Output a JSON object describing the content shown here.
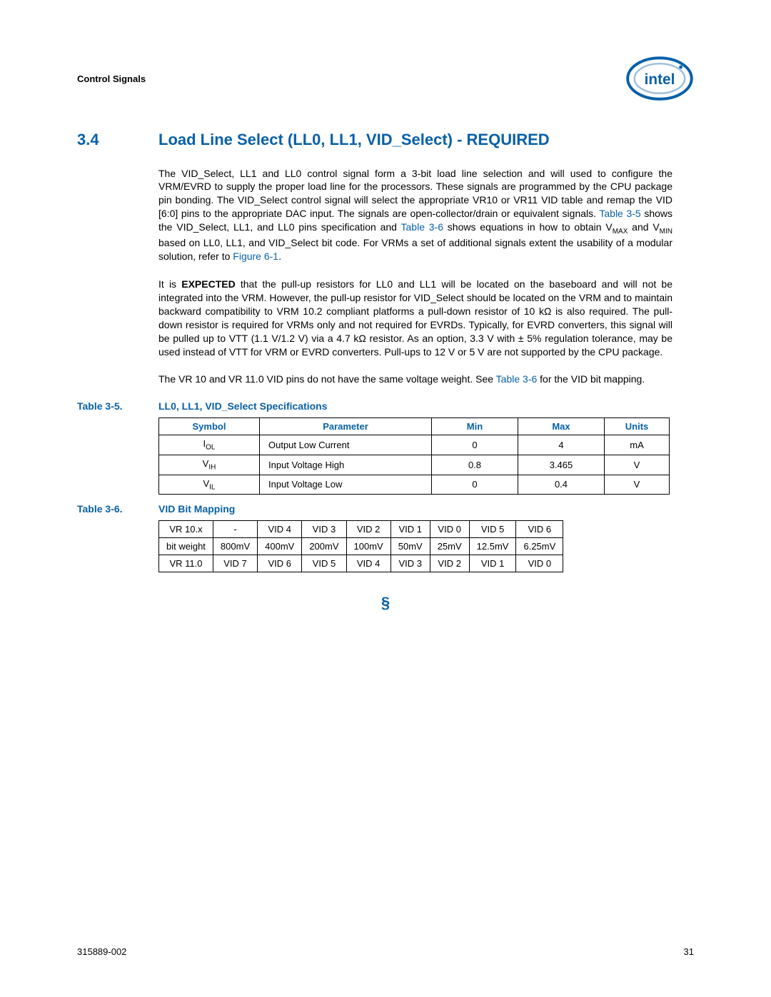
{
  "header": {
    "running": "Control Signals",
    "logo_text": "intel"
  },
  "section": {
    "number": "3.4",
    "title": "Load Line Select (LL0, LL1, VID_Select) - REQUIRED"
  },
  "paragraphs": {
    "p1_a": "The VID_Select, LL1 and LL0 control signal form a 3-bit load line selection and will used to configure the VRM/EVRD to supply the proper load line for the processors. These signals are programmed by the CPU package pin bonding. The VID_Select control signal will select the appropriate VR10 or VR11 VID table and remap the VID [6:0] pins to the appropriate DAC input. The signals are open-collector/drain or equivalent signals. ",
    "p1_link1": "Table 3-5",
    "p1_b": " shows the VID_Select, LL1, and LL0 pins specification and ",
    "p1_link2": "Table 3-6",
    "p1_c": " shows equations in how to obtain V",
    "p1_sub1": "MAX",
    "p1_d": " and V",
    "p1_sub2": "MIN",
    "p1_e": " based on LL0, LL1, and VID_Select bit code. For VRMs a set of additional signals extent the usability of a modular solution, refer to ",
    "p1_link3": "Figure 6-1",
    "p1_f": ".",
    "p2_a": "It is ",
    "p2_bold": "EXPECTED",
    "p2_b": " that the pull-up resistors for LL0 and LL1 will be located on the baseboard and will not be integrated into the VRM. However, the pull-up resistor for VID_Select should be located on the VRM and to maintain backward compatibility to VRM 10.2 compliant platforms a pull-down resistor of 10 kΩ is also required. The pull-down resistor is required for VRMs only and not required for EVRDs. Typically, for EVRD converters, this signal will be pulled up to VTT (1.1 V/1.2 V) via a 4.7 kΩ resistor. As an option, 3.3 V with ± 5% regulation tolerance, may be used instead of VTT for VRM or EVRD converters. Pull-ups to 12 V or 5 V are not supported by the CPU package.",
    "p3_a": "The VR 10 and VR 11.0 VID pins do not have the same voltage weight. See ",
    "p3_link1": "Table 3-6",
    "p3_b": " for the VID bit mapping."
  },
  "table35": {
    "caption_label": "Table 3-5.",
    "caption_title": "LL0, LL1, VID_Select Specifications",
    "headers": [
      "Symbol",
      "Parameter",
      "Min",
      "Max",
      "Units"
    ],
    "rows": [
      {
        "sym_pre": "I",
        "sym_sub": "OL",
        "param": "Output Low Current",
        "min": "0",
        "max": "4",
        "units": "mA"
      },
      {
        "sym_pre": "V",
        "sym_sub": "IH",
        "param": "Input Voltage High",
        "min": "0.8",
        "max": "3.465",
        "units": "V"
      },
      {
        "sym_pre": "V",
        "sym_sub": "IL",
        "param": "Input Voltage Low",
        "min": "0",
        "max": "0.4",
        "units": "V"
      }
    ]
  },
  "table36": {
    "caption_label": "Table 3-6.",
    "caption_title": "VID Bit Mapping",
    "rows": [
      [
        "VR 10.x",
        "-",
        "VID 4",
        "VID 3",
        "VID 2",
        "VID 1",
        "VID 0",
        "VID 5",
        "VID 6"
      ],
      [
        "bit weight",
        "800mV",
        "400mV",
        "200mV",
        "100mV",
        "50mV",
        "25mV",
        "12.5mV",
        "6.25mV"
      ],
      [
        "VR 11.0",
        "VID 7",
        "VID 6",
        "VID 5",
        "VID 4",
        "VID 3",
        "VID 2",
        "VID 1",
        "VID 0"
      ]
    ]
  },
  "section_mark": "§",
  "footer": {
    "left": "315889-002",
    "right": "31"
  }
}
